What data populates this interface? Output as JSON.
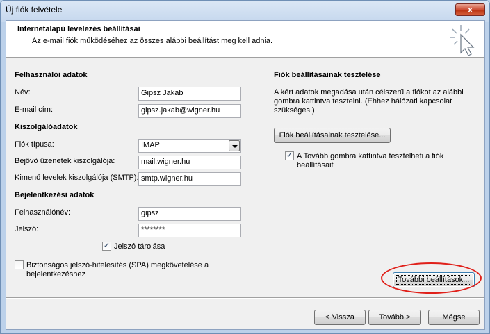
{
  "window": {
    "title": "Új fiók felvétele",
    "close_label": "x"
  },
  "header": {
    "title": "Internetalapú levelezés beállításai",
    "subtitle": "Az e-mail fiók működéséhez az összes alábbi beállítást meg kell adnia.",
    "icon": "wizard-cursor-icon"
  },
  "user_section": {
    "heading": "Felhasználói adatok",
    "name_label": "Név:",
    "name_value": "Gipsz Jakab",
    "email_label": "E-mail cím:",
    "email_value": "gipsz.jakab@wigner.hu"
  },
  "server_section": {
    "heading": "Kiszolgálóadatok",
    "account_type_label": "Fiók típusa:",
    "account_type_value": "IMAP",
    "incoming_label": "Bejövő üzenetek kiszolgálója:",
    "incoming_value": "mail.wigner.hu",
    "outgoing_label": "Kimenő levelek kiszolgálója (SMTP):",
    "outgoing_value": "smtp.wigner.hu"
  },
  "login_section": {
    "heading": "Bejelentkezési adatok",
    "username_label": "Felhasználónév:",
    "username_value": "gipsz",
    "password_label": "Jelszó:",
    "password_value": "********",
    "remember_password_label": "Jelszó tárolása",
    "remember_password_checked": true,
    "spa_label_line1": "Biztonságos jelszó-hitelesítés (SPA) megkövetelése a",
    "spa_label_line2": "bejelentkezéshez",
    "spa_checked": false
  },
  "test_section": {
    "heading": "Fiók beállításainak tesztelése",
    "desc_line1": "A kért adatok megadása után célszerű a fiókot az alábbi",
    "desc_line2": "gombra kattintva tesztelni. (Ehhez hálózati kapcsolat",
    "desc_line3": "szükséges.)",
    "test_button": "Fiók beállításainak tesztelése...",
    "auto_test_line1": "A Tovább gombra kattintva tesztelheti a fiók",
    "auto_test_line2": "beállításait",
    "auto_test_checked": true,
    "more_settings_button": "További beállítások..."
  },
  "footer": {
    "back_button": "< Vissza",
    "next_button": "Tovább >",
    "cancel_button": "Mégse"
  },
  "colors": {
    "highlight_ellipse": "#e0201a",
    "title_bar": "#c6d8ee"
  }
}
